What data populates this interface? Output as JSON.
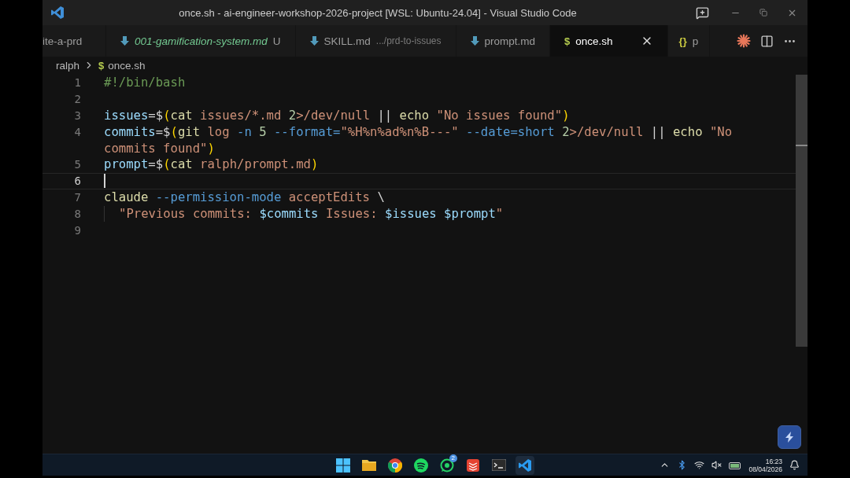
{
  "window": {
    "title": "once.sh - ai-engineer-workshop-2026-project [WSL: Ubuntu-24.04] - Visual Studio Code"
  },
  "tabs": [
    {
      "label": "ite-a-prd",
      "kind": "plain",
      "selected": false,
      "preview": false,
      "untracked": false
    },
    {
      "label": "001-gamification-system.md",
      "kind": "markdown",
      "selected": false,
      "preview": true,
      "untracked": true,
      "badge": "U"
    },
    {
      "label": "SKILL.md",
      "description": ".../prd-to-issues",
      "kind": "markdown",
      "selected": false,
      "preview": false,
      "untracked": false
    },
    {
      "label": "prompt.md",
      "kind": "markdown",
      "selected": false,
      "preview": false,
      "untracked": false
    },
    {
      "label": "once.sh",
      "kind": "shell",
      "glyph": "$",
      "selected": true,
      "preview": false,
      "untracked": false,
      "closable": true
    },
    {
      "label": "p",
      "kind": "json",
      "glyph": "{}",
      "selected": false,
      "preview": false,
      "untracked": false
    }
  ],
  "breadcrumb": {
    "folder": "ralph",
    "file_glyph": "$",
    "file": "once.sh"
  },
  "editor": {
    "rows": [
      {
        "number": "1",
        "tokens": [
          {
            "kind": "comment",
            "text": "#!/bin/bash"
          }
        ]
      },
      {
        "number": "2",
        "tokens": []
      },
      {
        "number": "3",
        "tokens": [
          {
            "kind": "var",
            "text": "issues"
          },
          {
            "kind": "op",
            "text": "=$"
          },
          {
            "kind": "paren",
            "text": "("
          },
          {
            "kind": "cmd",
            "text": "cat "
          },
          {
            "kind": "arg",
            "text": "issues/*.md "
          },
          {
            "kind": "num",
            "text": "2"
          },
          {
            "kind": "arg",
            "text": ">/dev/null "
          },
          {
            "kind": "op",
            "text": "|| "
          },
          {
            "kind": "cmd",
            "text": "echo "
          },
          {
            "kind": "string",
            "text": "\"No issues found\""
          },
          {
            "kind": "paren",
            "text": ")"
          }
        ]
      },
      {
        "number": "4",
        "tokens": [
          {
            "kind": "var",
            "text": "commits"
          },
          {
            "kind": "op",
            "text": "=$"
          },
          {
            "kind": "paren",
            "text": "("
          },
          {
            "kind": "cmd",
            "text": "git "
          },
          {
            "kind": "arg",
            "text": "log "
          },
          {
            "kind": "flag",
            "text": "-n "
          },
          {
            "kind": "num",
            "text": "5 "
          },
          {
            "kind": "flag",
            "text": "--format="
          },
          {
            "kind": "string",
            "text": "\"%H%n%ad%n%B---\" "
          },
          {
            "kind": "flag",
            "text": "--date=short "
          },
          {
            "kind": "num",
            "text": "2"
          },
          {
            "kind": "arg",
            "text": ">/dev/null "
          },
          {
            "kind": "op",
            "text": "|| "
          },
          {
            "kind": "cmd",
            "text": "echo "
          },
          {
            "kind": "string",
            "text": "\"No"
          }
        ]
      },
      {
        "tokens": [
          {
            "kind": "string",
            "text": "commits found\""
          },
          {
            "kind": "paren",
            "text": ")"
          }
        ]
      },
      {
        "number": "5",
        "tokens": [
          {
            "kind": "var",
            "text": "prompt"
          },
          {
            "kind": "op",
            "text": "=$"
          },
          {
            "kind": "paren",
            "text": "("
          },
          {
            "kind": "cmd",
            "text": "cat "
          },
          {
            "kind": "arg",
            "text": "ralph/prompt.md"
          },
          {
            "kind": "paren",
            "text": ")"
          }
        ]
      },
      {
        "number": "6",
        "current": true,
        "tokens": []
      },
      {
        "number": "7",
        "tokens": [
          {
            "kind": "cmd",
            "text": "claude "
          },
          {
            "kind": "flag",
            "text": "--permission-mode "
          },
          {
            "kind": "arg",
            "text": "acceptEdits "
          },
          {
            "kind": "op",
            "text": "\\"
          }
        ]
      },
      {
        "number": "8",
        "indent": true,
        "tokens": [
          {
            "kind": "string",
            "text": "\"Previous commits: "
          },
          {
            "kind": "var",
            "text": "$commits"
          },
          {
            "kind": "string",
            "text": " Issues: "
          },
          {
            "kind": "var",
            "text": "$issues "
          },
          {
            "kind": "var",
            "text": "$prompt"
          },
          {
            "kind": "string",
            "text": "\""
          }
        ]
      },
      {
        "number": "9",
        "tokens": []
      }
    ]
  },
  "taskbar": {
    "apps": [
      {
        "kind": "start",
        "selected": false
      },
      {
        "kind": "folder",
        "selected": false
      },
      {
        "kind": "chrome",
        "selected": false
      },
      {
        "kind": "spotify",
        "selected": false
      },
      {
        "kind": "whatsapp",
        "selected": false,
        "badge": "2"
      },
      {
        "kind": "redapp",
        "selected": false
      },
      {
        "kind": "terminal",
        "selected": false
      },
      {
        "kind": "vscode",
        "selected": true
      }
    ],
    "time": "16:23",
    "date": "08/04/2026"
  }
}
